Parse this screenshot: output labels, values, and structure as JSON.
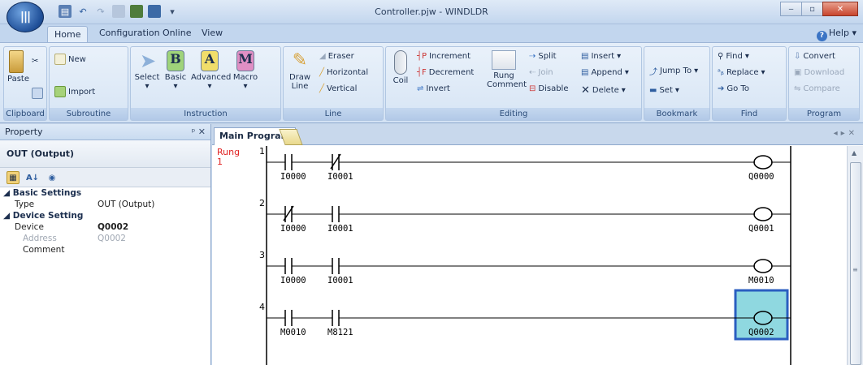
{
  "window": {
    "title": "Controller.pjw - WINDLDR"
  },
  "menu_tabs": [
    "Home",
    "Configuration",
    "Online",
    "View"
  ],
  "help_label": "Help",
  "ribbon": {
    "clipboard": {
      "label": "Clipboard",
      "paste": "Paste"
    },
    "subroutine": {
      "label": "Subroutine",
      "new": "New",
      "import": "Import"
    },
    "instruction": {
      "label": "Instruction",
      "select": "Select",
      "basic": "Basic",
      "advanced": "Advanced",
      "macro": "Macro",
      "basic_letter": "B",
      "advanced_letter": "A",
      "macro_letter": "M"
    },
    "line": {
      "label": "Line",
      "draw_line": "Draw Line",
      "eraser": "Eraser",
      "horizontal": "Horizontal",
      "vertical": "Vertical"
    },
    "editing": {
      "label": "Editing",
      "coil": "Coil",
      "increment": "Increment",
      "decrement": "Decrement",
      "invert": "Invert",
      "rung_comment": "Rung Comment",
      "split": "Split",
      "join": "Join",
      "disable": "Disable",
      "insert": "Insert",
      "append": "Append",
      "delete": "Delete"
    },
    "bookmark": {
      "label": "Bookmark",
      "jump_to": "Jump To",
      "set": "Set"
    },
    "find": {
      "label": "Find",
      "find": "Find",
      "replace": "Replace",
      "go_to": "Go To"
    },
    "program": {
      "label": "Program",
      "convert": "Convert",
      "download": "Download",
      "compare": "Compare"
    }
  },
  "property": {
    "pane_title": "Property",
    "header": "OUT (Output)",
    "sections": [
      {
        "name": "Basic Settings",
        "rows": [
          {
            "key": "Type",
            "value": "OUT (Output)"
          }
        ]
      },
      {
        "name": "Device Setting",
        "rows": [
          {
            "key": "Device",
            "value": "Q0002"
          },
          {
            "key": "Address",
            "value": "Q0002"
          },
          {
            "key": "Comment",
            "value": ""
          }
        ]
      }
    ]
  },
  "editor": {
    "tab": "Main Program",
    "rung_label": "Rung",
    "rung_label_num": "1",
    "rungs": [
      {
        "num": "1",
        "c1": "I0000",
        "c2": "I0001",
        "c1_type": "NO",
        "c2_type": "NC",
        "coil": "Q0000",
        "selected": false
      },
      {
        "num": "2",
        "c1": "I0000",
        "c2": "I0001",
        "c1_type": "NC",
        "c2_type": "NO",
        "coil": "Q0001",
        "selected": false
      },
      {
        "num": "3",
        "c1": "I0000",
        "c2": "I0001",
        "c1_type": "NO",
        "c2_type": "NO",
        "coil": "M0010",
        "selected": false
      },
      {
        "num": "4",
        "c1": "M0010",
        "c2": "M8121",
        "c1_type": "NO",
        "c2_type": "NO",
        "coil": "Q0002",
        "selected": true
      }
    ]
  },
  "colors": {
    "rung_label": "#e02020",
    "selection_border": "#2a5ec0",
    "selection_fill": "#8fd8e0"
  }
}
